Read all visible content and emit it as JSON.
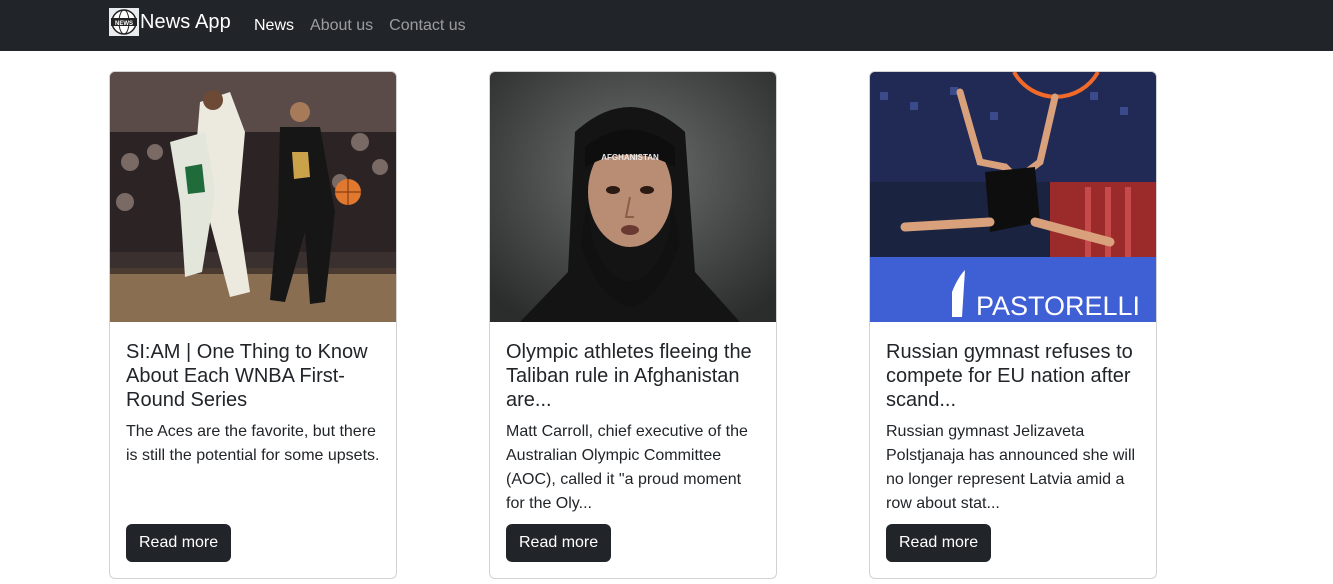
{
  "navbar": {
    "brand": "News App",
    "links": [
      "News",
      "About us",
      "Contact us"
    ],
    "logo_icon": "globe-news-icon"
  },
  "articles": [
    {
      "title": "SI:AM | One Thing to Know About Each WNBA First-Round Series",
      "description": "The Aces are the favorite, but there is still the potential for some upsets.",
      "button": "Read more"
    },
    {
      "title": "Olympic athletes fleeing the Taliban rule in Afghanistan are...",
      "description": "Matt Carroll, chief executive of the Australian Olympic Committee (AOC), called it \"a proud moment for the Oly...",
      "button": "Read more",
      "headband_text": "AFGHANISTAN"
    },
    {
      "title": "Russian gymnast refuses to compete for EU nation after scand...",
      "description": "Russian gymnast Jelizaveta Polstjanaja has announced she will no longer represent Latvia amid a row about stat...",
      "button": "Read more",
      "banner_text": "PASTORELLI"
    }
  ]
}
